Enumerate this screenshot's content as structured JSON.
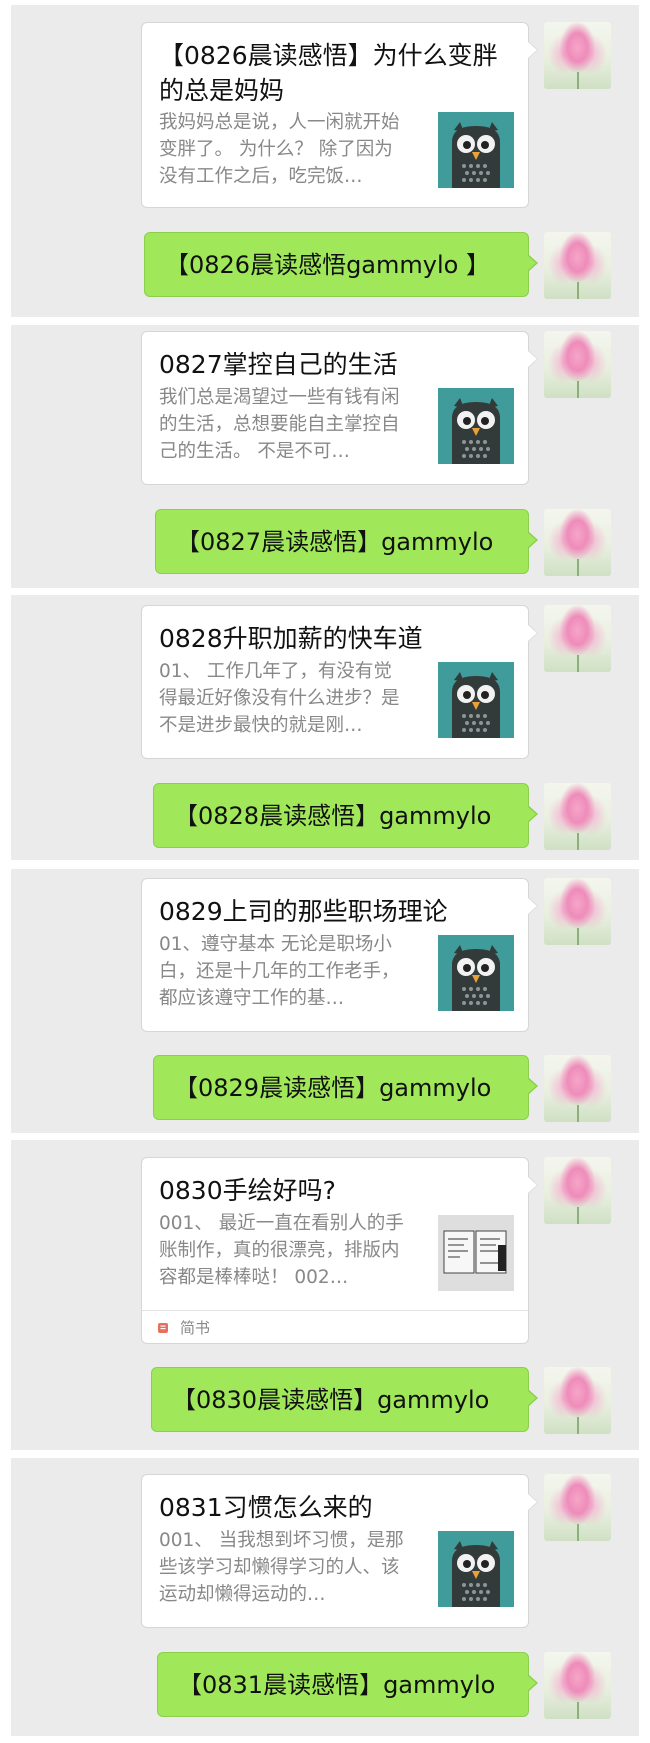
{
  "messages": [
    {
      "card": {
        "title": "【0826晨读感悟】为什么变胖的总是妈妈",
        "description": "我妈妈总是说，人一闲就开始变胖了。 为什么？ 除了因为没有工作之后，吃完饭…",
        "thumbnail_icon": "owl-icon"
      },
      "reply": "【0826晨读感悟gammylo 】"
    },
    {
      "card": {
        "title": "0827掌控自己的生活",
        "description": "我们总是渴望过一些有钱有闲的生活，总想要能自主掌控自己的生活。 不是不可…",
        "thumbnail_icon": "owl-icon"
      },
      "reply": "【0827晨读感悟】gammylo"
    },
    {
      "card": {
        "title": "0828升职加薪的快车道",
        "description": "01、 工作几年了，有没有觉得最近好像没有什么进步？是不是进步最快的就是刚…",
        "thumbnail_icon": "owl-icon"
      },
      "reply": "【0828晨读感悟】gammylo"
    },
    {
      "card": {
        "title": "0829上司的那些职场理论",
        "description": "01、遵守基本 无论是职场小白，还是十几年的工作老手，都应该遵守工作的基…",
        "thumbnail_icon": "owl-icon"
      },
      "reply": "【0829晨读感悟】gammylo"
    },
    {
      "card": {
        "title": "0830手绘好吗?",
        "description": "001、 最近一直在看别人的手账制作，真的很漂亮，排版内容都是棒棒哒！ 002…",
        "thumbnail_icon": "notebook-photo-icon",
        "source": "简书"
      },
      "reply": "【0830晨读感悟】gammylo"
    },
    {
      "card": {
        "title": "0831习惯怎么来的",
        "description": "001、 当我想到坏习惯，是那些该学习却懒得学习的人、该运动却懒得运动的…",
        "thumbnail_icon": "owl-icon"
      },
      "reply": "【0831晨读感悟】gammylo"
    }
  ],
  "colors": {
    "panel_bg": "#ebebeb",
    "bubble_green": "#a0e75a",
    "owl_teal": "#3f9c9a"
  },
  "avatar_icon": "lotus-flower-avatar"
}
